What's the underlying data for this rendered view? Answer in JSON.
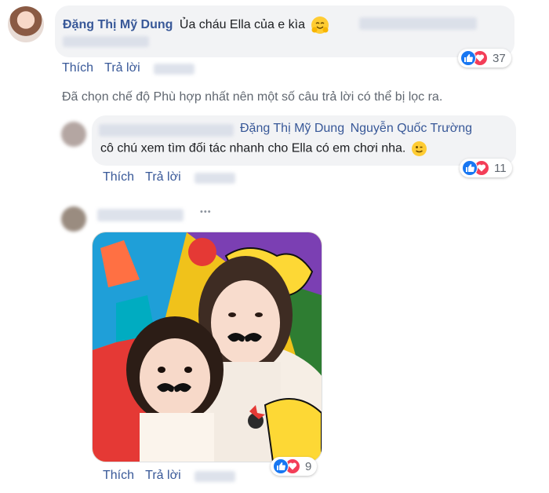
{
  "comment1": {
    "author": "Đặng Thị Mỹ Dung",
    "text": "Ủa cháu Ella của e kìa",
    "emoji": "hugging-face-icon",
    "actions": {
      "like": "Thích",
      "reply": "Trả lời"
    },
    "reaction_count": "37"
  },
  "filter_notice": "Đã chọn chế độ Phù hợp nhất nên một số câu trả lời có thể bị lọc ra.",
  "reply1": {
    "tag1": "Đặng Thị Mỹ Dung",
    "tag2": "Nguyễn Quốc Trường",
    "text": "cô chú xem tìm đối tác nhanh cho Ella có em chơi nha.",
    "emoji": "winking-face-icon",
    "actions": {
      "like": "Thích",
      "reply": "Trả lời"
    },
    "reaction_count": "11"
  },
  "reply2": {
    "more_label": "•••",
    "photo": "photo of a woman and a little girl with mustache stickers on a colorful comic frame",
    "actions": {
      "like": "Thích",
      "reply": "Trả lời"
    },
    "reaction_count": "9"
  },
  "colors": {
    "link": "#385898",
    "bubble": "#f2f3f5",
    "like": "#1877f2",
    "love": "#f33e58"
  }
}
